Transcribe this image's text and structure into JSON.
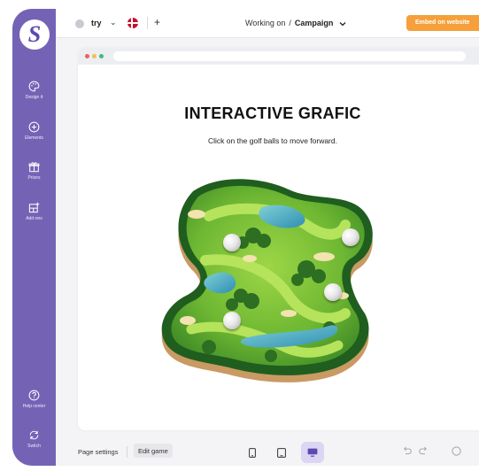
{
  "sidebar": {
    "logo_letter": "S",
    "items": [
      {
        "label": "Design it",
        "icon": "palette-icon"
      },
      {
        "label": "Elements",
        "icon": "plus-circle-icon"
      },
      {
        "label": "Prizes",
        "icon": "gift-icon"
      },
      {
        "label": "Add-ons",
        "icon": "add-ons-icon"
      }
    ],
    "bottom_items": [
      {
        "label": "Help center",
        "icon": "help-icon"
      },
      {
        "label": "Switch",
        "icon": "switch-icon"
      }
    ]
  },
  "topbar": {
    "workspace_name": "try",
    "chevron": "⌄",
    "language_flag": "Denmark",
    "add_symbol": "+",
    "working_on_label": "Working on",
    "separator": "/",
    "campaign_label": "Campaign",
    "embed_button": "Embed on website"
  },
  "canvas": {
    "title": "INTERACTIVE GRAFIC",
    "subtitle": "Click on the golf balls to move forward.",
    "window_dot_colors": [
      "#f0605a",
      "#f5bd4f",
      "#3fbd7a"
    ]
  },
  "bottombar": {
    "page_settings": "Page settings",
    "edit_game": "Edit game",
    "devices": [
      "mobile",
      "tablet",
      "desktop"
    ],
    "active_device": "desktop"
  },
  "colors": {
    "sidebar": "#7463b5",
    "accent_orange": "#f5a03a",
    "active_device_bg": "#dcd5f3"
  }
}
